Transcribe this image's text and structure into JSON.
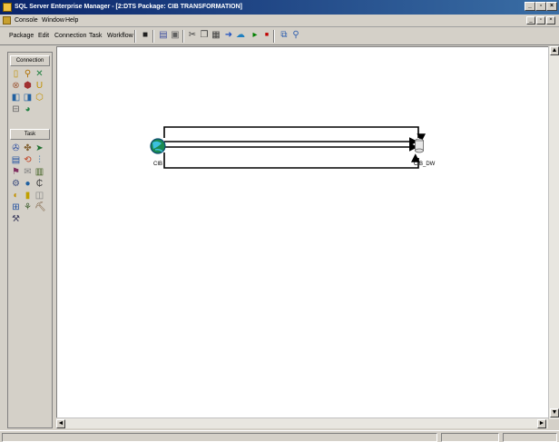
{
  "window": {
    "title": "SQL Server Enterprise Manager - [2:DTS Package: CIB TRANSFORMATION]",
    "min": "_",
    "max": "▫",
    "close": "×"
  },
  "menubar": {
    "items": [
      "Console",
      "Window",
      "Help"
    ],
    "mdi": {
      "min": "_",
      "max": "▫",
      "close": "×"
    }
  },
  "toolbar": {
    "menus": [
      "Package",
      "Edit",
      "Connection",
      "Task",
      "Workflow"
    ],
    "icons": [
      "save-icon",
      "print-icon",
      "properties-icon",
      "cut-icon",
      "copy-icon",
      "paste-icon",
      "execute-icon",
      "routing-icon",
      "run-icon",
      "stop-icon",
      "layout-icon",
      "zoom-icon"
    ],
    "colors": {
      "save": "#202020",
      "print": "#4050a0",
      "run": "#008000",
      "stop": "#c00000"
    }
  },
  "leftpanel": {
    "connection_header": "Connection",
    "task_header": "Task"
  },
  "canvas": {
    "source_label": "CIB",
    "destination_label": "CIB_DW"
  },
  "scroll": {
    "up": "▲",
    "down": "▼",
    "left": "◄",
    "right": "►"
  }
}
